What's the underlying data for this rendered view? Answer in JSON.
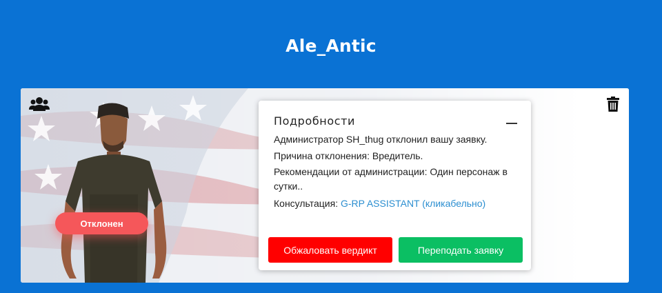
{
  "header": {
    "title": "Ale_Antic"
  },
  "card": {
    "status_badge": "Отклонен",
    "details": {
      "title": "Подробности",
      "admin_message": "Администратор SH_thug отклонил вашу заявку.",
      "reason": "Причина отклонения: Вредитель.",
      "recommendations": "Рекомендации от администрации: Один персонаж в сутки..",
      "consultation_label": "Консультация:",
      "consultation_link": "G-RP ASSISTANT (кликабельно)",
      "appeal_button": "Обжаловать вердикт",
      "resubmit_button": "Переподать заявку"
    }
  },
  "icons": {
    "group": "users-icon",
    "delete": "trash-icon",
    "collapse": "minus-icon"
  },
  "colors": {
    "background": "#0a72d4",
    "badge": "#f5575a",
    "appeal": "#ff0000",
    "resubmit": "#0bbf63",
    "link": "#2b8ed0"
  }
}
